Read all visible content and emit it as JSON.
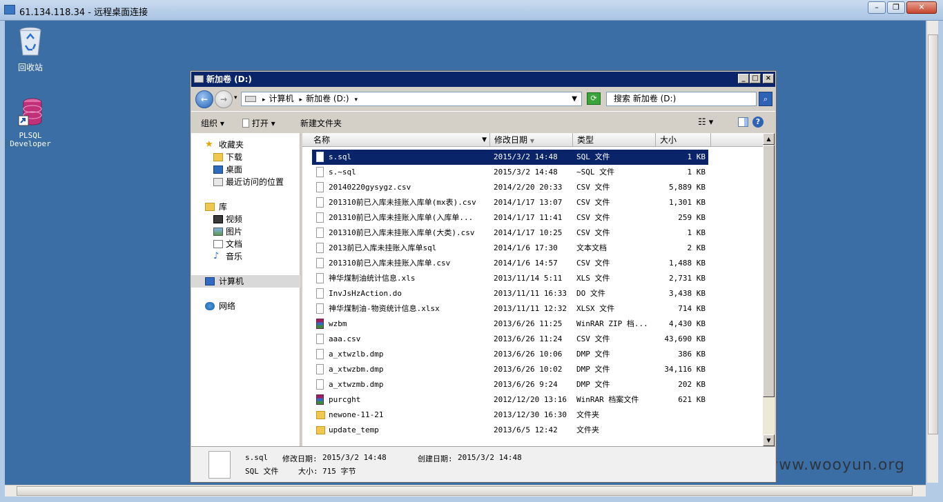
{
  "rdp": {
    "title": "61.134.118.34 - 远程桌面连接"
  },
  "desktop": {
    "icons": [
      {
        "label": "回收站"
      },
      {
        "label": "PLSQL\nDeveloper",
        "line1": "PLSQL",
        "line2": "Developer"
      }
    ],
    "watermark": "www.wooyun.org"
  },
  "explorer": {
    "title": "新加卷 (D:)",
    "address": {
      "root_icon": "drive-icon",
      "segments": [
        "计算机",
        "新加卷 (D:)"
      ]
    },
    "search_placeholder": "搜索 新加卷 (D:)",
    "toolbar": {
      "organize": "组织",
      "open": "打开",
      "new_folder": "新建文件夹"
    },
    "nav": {
      "favorites": "收藏夹",
      "downloads": "下载",
      "desktop": "桌面",
      "recent": "最近访问的位置",
      "libraries": "库",
      "videos": "视频",
      "pictures": "图片",
      "documents": "文档",
      "music": "音乐",
      "computer": "计算机",
      "network": "网络"
    },
    "columns": {
      "name": "名称",
      "modified": "修改日期",
      "type": "类型",
      "size": "大小"
    },
    "files": [
      {
        "name": "s.sql",
        "date": "2015/3/2 14:48",
        "type": "SQL 文件",
        "size": "1 KB",
        "icon": "file"
      },
      {
        "name": "s.~sql",
        "date": "2015/3/2 14:48",
        "type": "~SQL 文件",
        "size": "1 KB",
        "icon": "file"
      },
      {
        "name": "20140220gysygz.csv",
        "date": "2014/2/20 20:33",
        "type": "CSV 文件",
        "size": "5,889 KB",
        "icon": "file"
      },
      {
        "name": "201310前已入库未挂账入库单(mx表).csv",
        "date": "2014/1/17 13:07",
        "type": "CSV 文件",
        "size": "1,301 KB",
        "icon": "file"
      },
      {
        "name": "201310前已入库未挂账入库单(入库单...",
        "date": "2014/1/17 11:41",
        "type": "CSV 文件",
        "size": "259 KB",
        "icon": "file"
      },
      {
        "name": "201310前已入库未挂账入库单(大类).csv",
        "date": "2014/1/17 10:25",
        "type": "CSV 文件",
        "size": "1 KB",
        "icon": "file"
      },
      {
        "name": "2013前已入库未挂账入库单sql",
        "date": "2014/1/6 17:30",
        "type": "文本文档",
        "size": "2 KB",
        "icon": "file"
      },
      {
        "name": "201310前已入库未挂账入库单.csv",
        "date": "2014/1/6 14:57",
        "type": "CSV 文件",
        "size": "1,488 KB",
        "icon": "file"
      },
      {
        "name": "神华煤制油统计信息.xls",
        "date": "2013/11/14 5:11",
        "type": "XLS 文件",
        "size": "2,731 KB",
        "icon": "file"
      },
      {
        "name": "InvJsHzAction.do",
        "date": "2013/11/11 16:33",
        "type": "DO 文件",
        "size": "3,438 KB",
        "icon": "file"
      },
      {
        "name": "神华煤制油-物资统计信息.xlsx",
        "date": "2013/11/11 12:32",
        "type": "XLSX 文件",
        "size": "714 KB",
        "icon": "file"
      },
      {
        "name": "wzbm",
        "date": "2013/6/26 11:25",
        "type": "WinRAR ZIP 档...",
        "size": "4,430 KB",
        "icon": "rar"
      },
      {
        "name": "aaa.csv",
        "date": "2013/6/26 11:24",
        "type": "CSV 文件",
        "size": "43,690 KB",
        "icon": "file"
      },
      {
        "name": "a_xtwzlb.dmp",
        "date": "2013/6/26 10:06",
        "type": "DMP 文件",
        "size": "386 KB",
        "icon": "file"
      },
      {
        "name": "a_xtwzbm.dmp",
        "date": "2013/6/26 10:02",
        "type": "DMP 文件",
        "size": "34,116 KB",
        "icon": "file"
      },
      {
        "name": "a_xtwzmb.dmp",
        "date": "2013/6/26 9:24",
        "type": "DMP 文件",
        "size": "202 KB",
        "icon": "file"
      },
      {
        "name": "purcght",
        "date": "2012/12/20 13:16",
        "type": "WinRAR 档案文件",
        "size": "621 KB",
        "icon": "rar"
      },
      {
        "name": "newone-11-21",
        "date": "2013/12/30 16:30",
        "type": "文件夹",
        "size": "",
        "icon": "dir"
      },
      {
        "name": "update_temp",
        "date": "2013/6/5 12:42",
        "type": "文件夹",
        "size": "",
        "icon": "dir"
      }
    ],
    "details": {
      "name": "s.sql",
      "modified_label": "修改日期:",
      "modified": "2015/3/2 14:48",
      "created_label": "创建日期:",
      "created": "2015/3/2 14:48",
      "type": "SQL 文件",
      "size_label": "大小:",
      "size": "715 字节"
    }
  }
}
